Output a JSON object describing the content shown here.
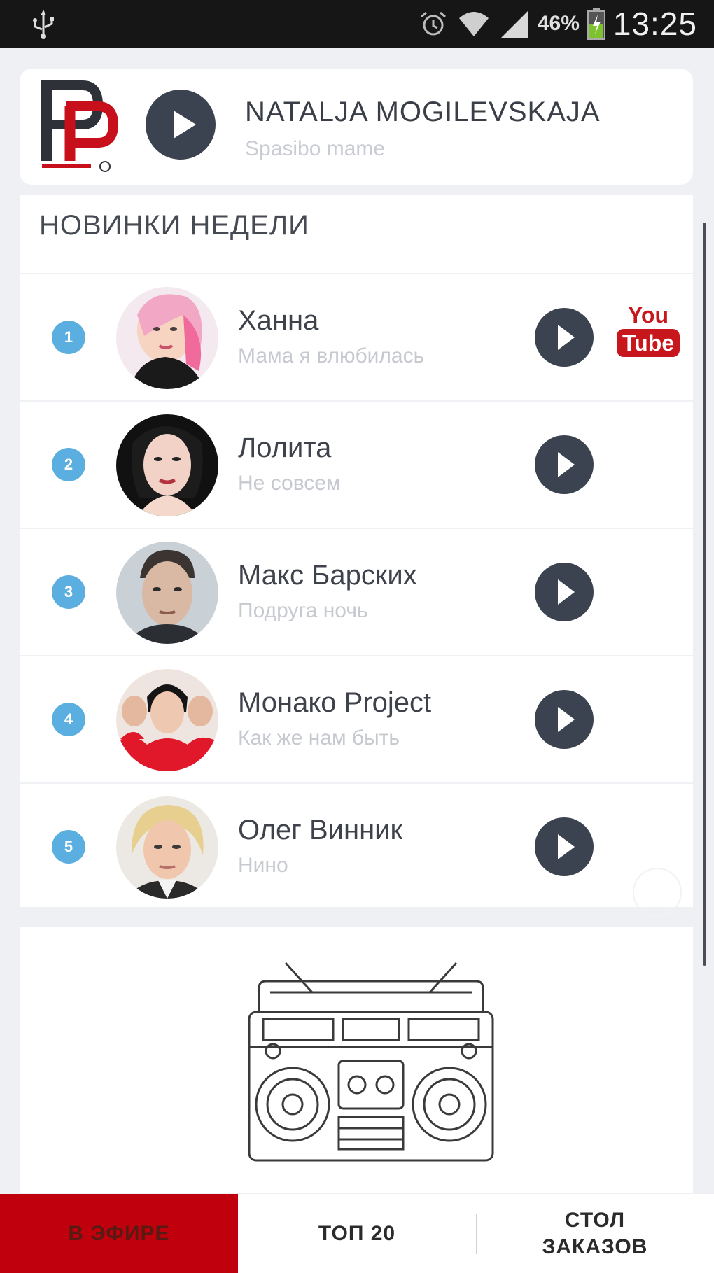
{
  "status_bar": {
    "time": "13:25",
    "battery": "46%",
    "icons": [
      "usb-icon",
      "alarm-icon",
      "wifi-icon",
      "signal-icon",
      "battery-icon"
    ]
  },
  "now_playing": {
    "artist": "NATALJA MOGILEVSKAJA",
    "song": "Spasibo mame",
    "logo": "pp-radio-logo"
  },
  "week_list": {
    "title": "НОВИНКИ НЕДЕЛИ",
    "items": [
      {
        "rank": "1",
        "artist": "Ханна",
        "song": "Мама я влюбилась",
        "youtube": true
      },
      {
        "rank": "2",
        "artist": "Лолита",
        "song": "Не совсем",
        "youtube": false
      },
      {
        "rank": "3",
        "artist": "Макс Барских",
        "song": "Подруга ночь",
        "youtube": false
      },
      {
        "rank": "4",
        "artist": "Монако Project",
        "song": "Как же нам быть",
        "youtube": false
      },
      {
        "rank": "5",
        "artist": "Олег Винник",
        "song": "Нино",
        "youtube": false
      }
    ]
  },
  "youtube_badge": {
    "top": "You",
    "bottom": "Tube"
  },
  "bottom_nav": {
    "live": "В ЭФИРЕ",
    "top20": "ТОП 20",
    "orders_line1": "СТОЛ",
    "orders_line2": "ЗАКАЗОВ"
  },
  "colors": {
    "accent": "#c0000c",
    "play_button": "#3c4350",
    "rank_badge": "#5aaee0",
    "youtube": "#c8161d"
  }
}
